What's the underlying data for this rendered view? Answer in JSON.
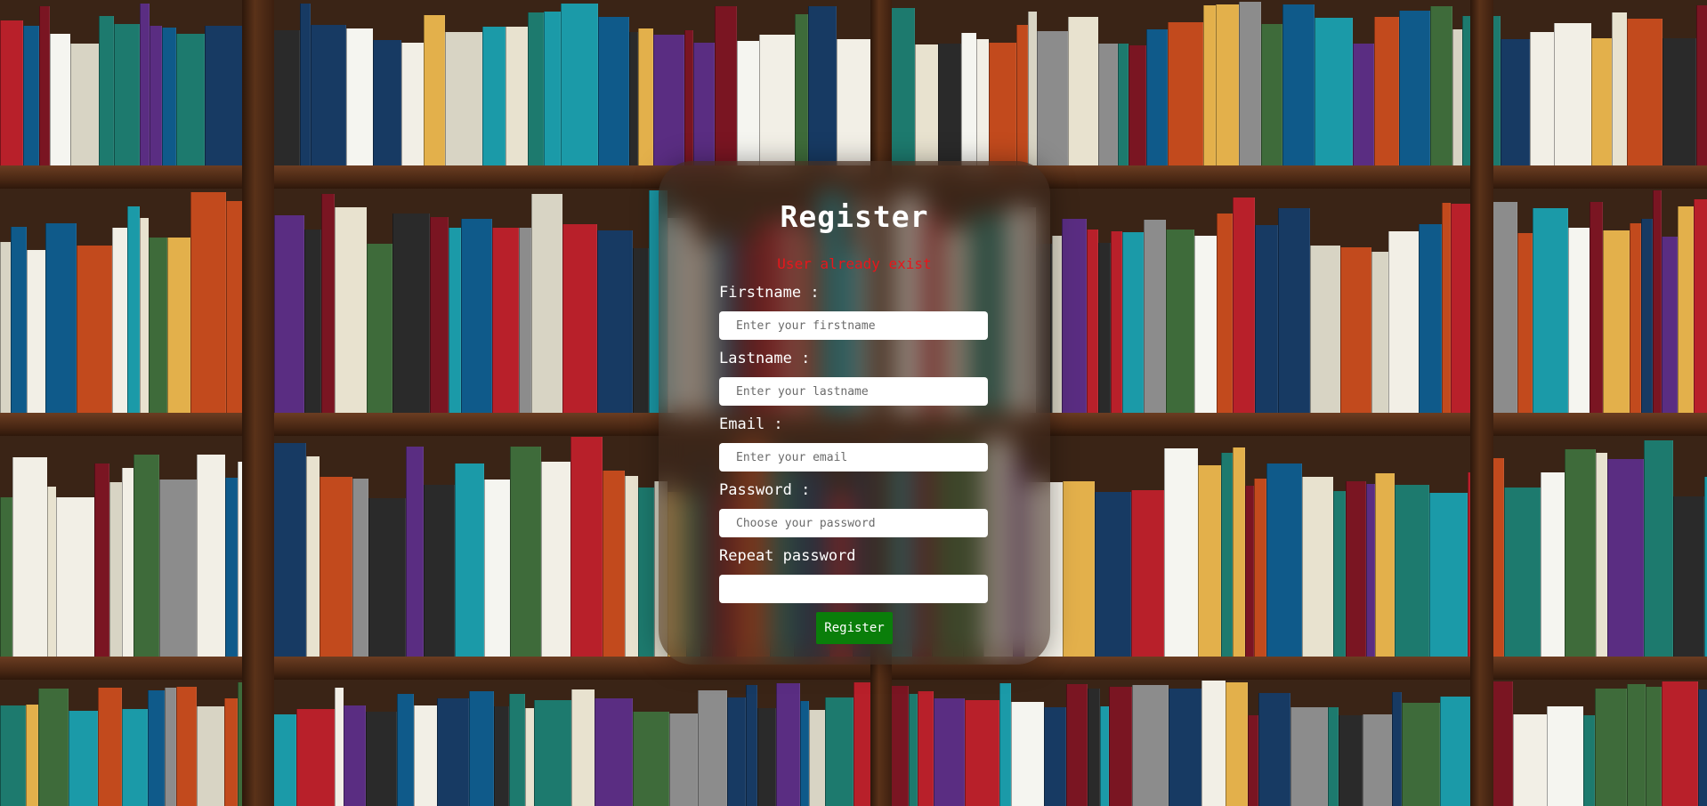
{
  "form": {
    "title": "Register",
    "error_message": "User already exist",
    "fields": [
      {
        "label": "Firstname :",
        "placeholder": "Enter your firstname",
        "value": ""
      },
      {
        "label": "Lastname :",
        "placeholder": "Enter your lastname",
        "value": ""
      },
      {
        "label": "Email :",
        "placeholder": "Enter your email",
        "value": ""
      },
      {
        "label": "Password :",
        "placeholder": "Choose your password",
        "value": ""
      },
      {
        "label": "Repeat password",
        "placeholder": "",
        "value": ""
      }
    ],
    "submit_label": "Register"
  },
  "colors": {
    "error": "#e8161b",
    "submit_button": "#0a7e0a",
    "title": "#ffffff"
  }
}
